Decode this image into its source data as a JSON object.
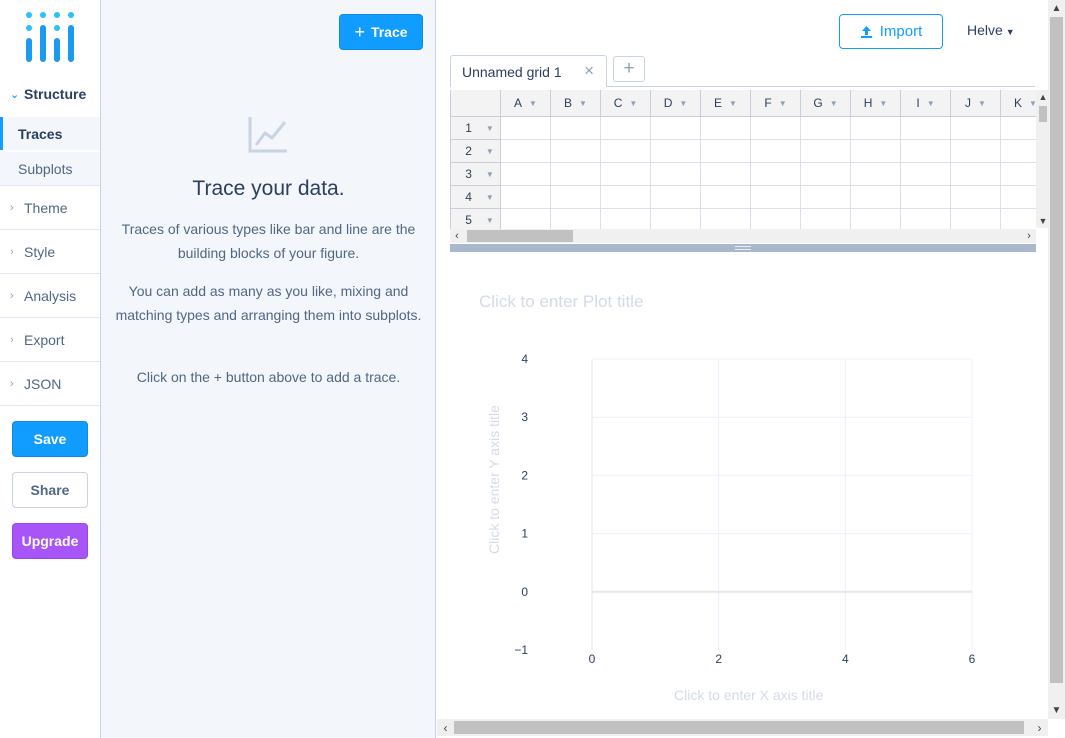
{
  "nav": {
    "structure_label": "Structure",
    "sub_items": [
      "Traces",
      "Subplots"
    ],
    "items": [
      "Theme",
      "Style",
      "Analysis",
      "Export",
      "JSON"
    ],
    "save_label": "Save",
    "share_label": "Share",
    "upgrade_label": "Upgrade"
  },
  "panel": {
    "trace_button": "Trace",
    "empty_title": "Trace your data.",
    "empty_text_1": "Traces of various types like bar and line are the building blocks of your figure.",
    "empty_text_2": "You can add as many as you like, mixing and matching types and arranging them into subplots.",
    "empty_text_3": "Click on the + button above to add a trace."
  },
  "toolbar": {
    "import_label": "Import",
    "font_label": "Helve"
  },
  "grid": {
    "tab_label": "Unnamed grid 1",
    "columns": [
      "A",
      "B",
      "C",
      "D",
      "E",
      "F",
      "G",
      "H",
      "I",
      "J",
      "K"
    ],
    "rows": [
      "1",
      "2",
      "3",
      "4",
      "5"
    ]
  },
  "plot": {
    "title_placeholder": "Click to enter Plot title",
    "x_title_placeholder": "Click to enter X axis title",
    "y_title_placeholder": "Click to enter Y axis title"
  },
  "chart_data": {
    "type": "scatter",
    "title": "Click to enter Plot title",
    "xlabel": "Click to enter X axis title",
    "ylabel": "Click to enter Y axis title",
    "xlim": [
      -1,
      6
    ],
    "ylim": [
      -1,
      4
    ],
    "x_ticks": [
      0,
      2,
      4,
      6
    ],
    "y_ticks": [
      -1,
      0,
      1,
      2,
      3,
      4
    ],
    "x_tick_labels": [
      "0",
      "2",
      "4",
      "6"
    ],
    "y_tick_labels": [
      "−1",
      "0",
      "1",
      "2",
      "3",
      "4"
    ],
    "series": [],
    "grid": true
  },
  "colors": {
    "accent": "#119dff",
    "upgrade": "#a855f7",
    "text_dark": "#2a3f5f",
    "text": "#506784",
    "panel_bg": "#f3f6fa",
    "placeholder": "#d4dbe6"
  }
}
